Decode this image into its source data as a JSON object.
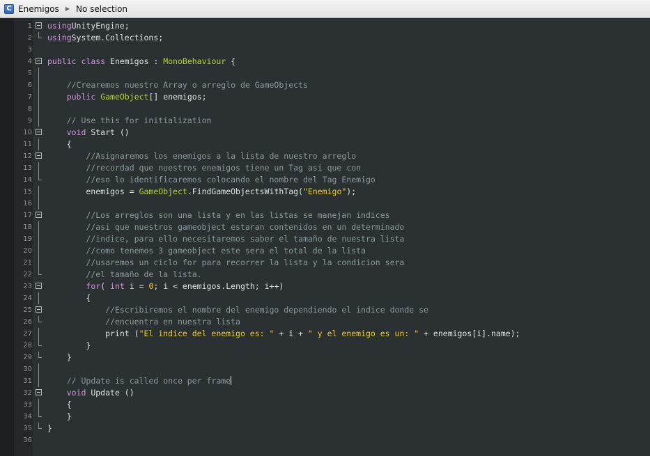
{
  "titlebar": {
    "file_name": "Enemigos",
    "selection": "No selection",
    "file_icon_letter": "C"
  },
  "editor": {
    "lines": [
      {
        "n": "1",
        "fold": "box",
        "tokens": [
          [
            "kw",
            "using"
          ],
          [
            "",
            "UnityEngine;"
          ]
        ]
      },
      {
        "n": "2",
        "fold": "end",
        "tokens": [
          [
            "kw",
            "using"
          ],
          [
            "",
            "System.Collections;"
          ]
        ]
      },
      {
        "n": "3",
        "fold": "",
        "tokens": []
      },
      {
        "n": "4",
        "fold": "box",
        "tokens": [
          [
            "kw",
            "public"
          ],
          [
            "",
            " "
          ],
          [
            "kw",
            "class"
          ],
          [
            "",
            " Enemigos : "
          ],
          [
            "ty",
            "MonoBehaviour"
          ],
          [
            "",
            " {"
          ]
        ]
      },
      {
        "n": "5",
        "fold": "line",
        "tokens": []
      },
      {
        "n": "6",
        "fold": "line",
        "tokens": [
          [
            "",
            "    "
          ],
          [
            "cm",
            "//Crearemos nuestro Array o arreglo de GameObjects"
          ]
        ]
      },
      {
        "n": "7",
        "fold": "line",
        "tokens": [
          [
            "",
            "    "
          ],
          [
            "kw",
            "public"
          ],
          [
            "",
            " "
          ],
          [
            "ty",
            "GameObject"
          ],
          [
            "",
            "[] enemigos;"
          ]
        ]
      },
      {
        "n": "8",
        "fold": "line",
        "tokens": []
      },
      {
        "n": "9",
        "fold": "line",
        "tokens": [
          [
            "",
            "    "
          ],
          [
            "cm",
            "// Use this for initialization"
          ]
        ]
      },
      {
        "n": "10",
        "fold": "box",
        "tokens": [
          [
            "",
            "    "
          ],
          [
            "kw",
            "void"
          ],
          [
            "",
            " Start ()"
          ]
        ]
      },
      {
        "n": "11",
        "fold": "line",
        "tokens": [
          [
            "",
            "    {"
          ]
        ]
      },
      {
        "n": "12",
        "fold": "box",
        "tokens": [
          [
            "",
            "        "
          ],
          [
            "cm",
            "//Asignaremos los enemigos a la lista de nuestro arreglo"
          ]
        ]
      },
      {
        "n": "13",
        "fold": "line",
        "tokens": [
          [
            "",
            "        "
          ],
          [
            "cm",
            "//recordad que nuestros enemigos tiene un Tag asi que con"
          ]
        ]
      },
      {
        "n": "14",
        "fold": "end",
        "tokens": [
          [
            "",
            "        "
          ],
          [
            "cm",
            "//eso lo identificaremos colocando el nombre del Tag Enemigo"
          ]
        ]
      },
      {
        "n": "15",
        "fold": "line",
        "tokens": [
          [
            "",
            "        enemigos = "
          ],
          [
            "ty",
            "GameObject"
          ],
          [
            "",
            ".FindGameObjectsWithTag("
          ],
          [
            "st",
            "\"Enemigo\""
          ],
          [
            "",
            ");"
          ]
        ]
      },
      {
        "n": "16",
        "fold": "line",
        "tokens": []
      },
      {
        "n": "17",
        "fold": "box",
        "tokens": [
          [
            "",
            "        "
          ],
          [
            "cm",
            "//Los arreglos son una lista y en las listas se manejan indices"
          ]
        ]
      },
      {
        "n": "18",
        "fold": "line",
        "tokens": [
          [
            "",
            "        "
          ],
          [
            "cm",
            "//asi que nuestros gameobject estaran contenidos en un determinado"
          ]
        ]
      },
      {
        "n": "19",
        "fold": "line",
        "tokens": [
          [
            "",
            "        "
          ],
          [
            "cm",
            "//indice, para ello necesitaremos saber el tamaño de nuestra lista"
          ]
        ]
      },
      {
        "n": "20",
        "fold": "line",
        "tokens": [
          [
            "",
            "        "
          ],
          [
            "cm",
            "//como tenemos 3 gameobject este sera el total de la lista"
          ]
        ]
      },
      {
        "n": "21",
        "fold": "line",
        "tokens": [
          [
            "",
            "        "
          ],
          [
            "cm",
            "//usaremos un ciclo for para recorrer la lista y la condicion sera"
          ]
        ]
      },
      {
        "n": "22",
        "fold": "end",
        "tokens": [
          [
            "",
            "        "
          ],
          [
            "cm",
            "//el tamaño de la lista."
          ]
        ]
      },
      {
        "n": "23",
        "fold": "box",
        "tokens": [
          [
            "",
            "        "
          ],
          [
            "kw",
            "for"
          ],
          [
            "",
            "( "
          ],
          [
            "kw",
            "int"
          ],
          [
            "",
            " i = "
          ],
          [
            "nm",
            "0"
          ],
          [
            "",
            "; i < enemigos.Length; i++)"
          ]
        ]
      },
      {
        "n": "24",
        "fold": "line",
        "tokens": [
          [
            "",
            "        {"
          ]
        ]
      },
      {
        "n": "25",
        "fold": "box",
        "tokens": [
          [
            "",
            "            "
          ],
          [
            "cm",
            "//Escribiremos el nombre del enemigo dependiendo el indice donde se"
          ]
        ]
      },
      {
        "n": "26",
        "fold": "end",
        "tokens": [
          [
            "",
            "            "
          ],
          [
            "cm",
            "//encuentra en nuestra lista"
          ]
        ]
      },
      {
        "n": "27",
        "fold": "line",
        "tokens": [
          [
            "",
            "            print ("
          ],
          [
            "st",
            "\"El indice del enemigo es: \""
          ],
          [
            "",
            " + i + "
          ],
          [
            "st",
            "\" y el enemigo es un: \""
          ],
          [
            "",
            " + enemigos[i].name);"
          ]
        ]
      },
      {
        "n": "28",
        "fold": "end",
        "tokens": [
          [
            "",
            "        }"
          ]
        ]
      },
      {
        "n": "29",
        "fold": "end",
        "tokens": [
          [
            "",
            "    }"
          ]
        ]
      },
      {
        "n": "30",
        "fold": "line",
        "tokens": []
      },
      {
        "n": "31",
        "fold": "line",
        "tokens": [
          [
            "",
            "    "
          ],
          [
            "cm",
            "// Update is called once per frame"
          ],
          [
            "caret",
            ""
          ]
        ]
      },
      {
        "n": "32",
        "fold": "box",
        "tokens": [
          [
            "",
            "    "
          ],
          [
            "kw",
            "void"
          ],
          [
            "",
            " Update ()"
          ]
        ]
      },
      {
        "n": "33",
        "fold": "line",
        "tokens": [
          [
            "",
            "    {"
          ]
        ]
      },
      {
        "n": "34",
        "fold": "end",
        "tokens": [
          [
            "",
            "    }"
          ]
        ]
      },
      {
        "n": "35",
        "fold": "end",
        "tokens": [
          [
            "",
            "}"
          ]
        ]
      },
      {
        "n": "36",
        "fold": "",
        "tokens": []
      }
    ]
  }
}
